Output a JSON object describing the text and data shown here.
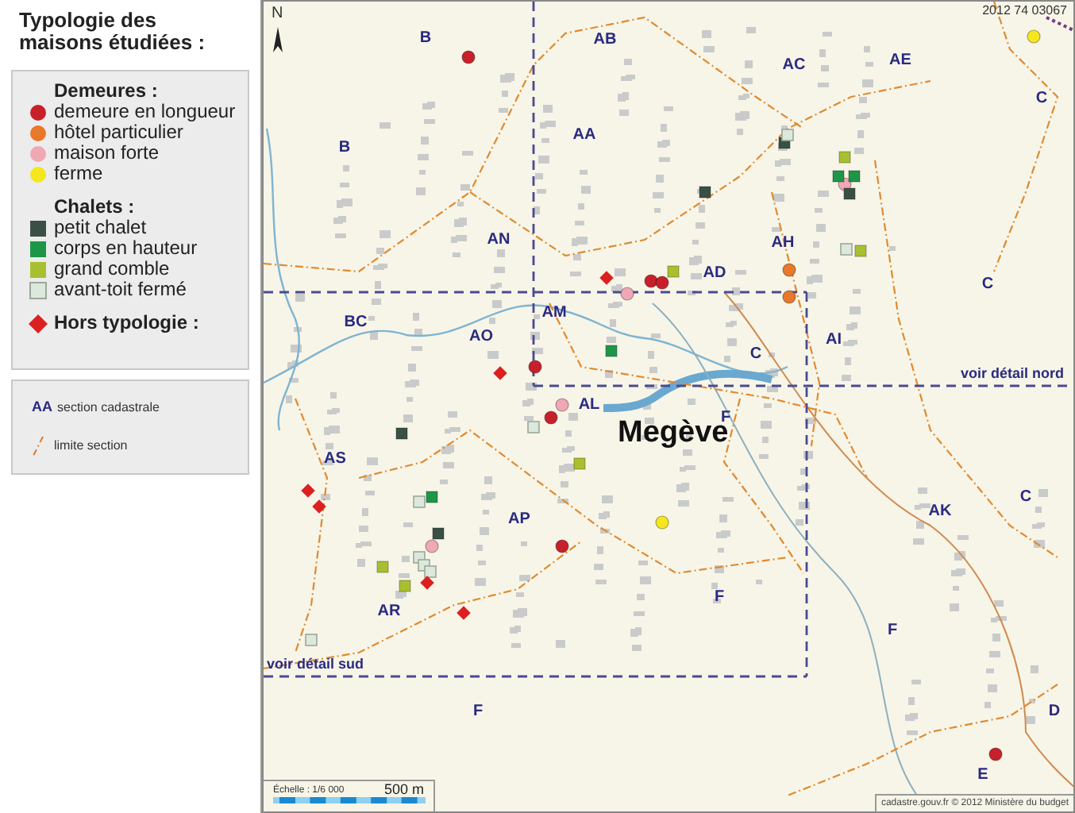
{
  "legend": {
    "title": "Typologie des maisons étudiées :",
    "groups": [
      {
        "title": "Demeures :",
        "items": [
          {
            "kind": "circle",
            "color": "#c8202a",
            "label": "demeure en longueur"
          },
          {
            "kind": "circle",
            "color": "#e8782a",
            "label": "hôtel particulier"
          },
          {
            "kind": "circle",
            "color": "#f0a8b4",
            "label": "maison forte"
          },
          {
            "kind": "circle",
            "color": "#f5e61e",
            "label": "ferme"
          }
        ]
      },
      {
        "title": "Chalets :",
        "items": [
          {
            "kind": "square",
            "color": "#3a5045",
            "label": "petit chalet"
          },
          {
            "kind": "square",
            "color": "#1e9648",
            "label": "corps en hauteur"
          },
          {
            "kind": "square",
            "color": "#a8c030",
            "label": "grand comble"
          },
          {
            "kind": "square",
            "color": "#dce8dc",
            "label": "avant-toit fermé"
          }
        ]
      },
      {
        "title": "Hors typologie :",
        "kind": "diamond",
        "color": "#dc2020"
      }
    ],
    "key": {
      "code": "AA",
      "code_label": "section cadastrale",
      "line_label": "limite section"
    }
  },
  "map": {
    "ref": "2012 74 03067",
    "north": "N",
    "town": "Megève",
    "detail_nord": "voir détail nord",
    "detail_sud": "voir détail sud",
    "scale": {
      "label": "Échelle : 1/6 000",
      "distance": "500 m"
    },
    "credit": "cadastre.gouv.fr © 2012 Ministère du budget",
    "sections": [
      {
        "text": "B"
      },
      {
        "text": "AB"
      },
      {
        "text": "AC"
      },
      {
        "text": "AE"
      },
      {
        "text": "C"
      },
      {
        "text": "B"
      },
      {
        "text": "AA"
      },
      {
        "text": "AN"
      },
      {
        "text": "AH"
      },
      {
        "text": "AD"
      },
      {
        "text": "C"
      },
      {
        "text": "BC"
      },
      {
        "text": "AM"
      },
      {
        "text": "AO"
      },
      {
        "text": "C"
      },
      {
        "text": "AI"
      },
      {
        "text": "AL"
      },
      {
        "text": "F"
      },
      {
        "text": "AS"
      },
      {
        "text": "AP"
      },
      {
        "text": "AK"
      },
      {
        "text": "C"
      },
      {
        "text": "AR"
      },
      {
        "text": "F"
      },
      {
        "text": "F"
      },
      {
        "text": "F"
      },
      {
        "text": "D"
      },
      {
        "text": "E"
      }
    ],
    "markers": [
      {
        "kind": "circle",
        "color": "#c8202a"
      },
      {
        "kind": "circle",
        "color": "#c8202a"
      },
      {
        "kind": "circle",
        "color": "#c8202a"
      },
      {
        "kind": "circle",
        "color": "#c8202a"
      },
      {
        "kind": "circle",
        "color": "#c8202a"
      },
      {
        "kind": "circle",
        "color": "#c8202a"
      },
      {
        "kind": "circle",
        "color": "#c8202a"
      },
      {
        "kind": "circle",
        "color": "#e8782a"
      },
      {
        "kind": "circle",
        "color": "#e8782a"
      },
      {
        "kind": "circle",
        "color": "#f0a8b4"
      },
      {
        "kind": "circle",
        "color": "#f0a8b4"
      },
      {
        "kind": "circle",
        "color": "#f0a8b4"
      },
      {
        "kind": "circle",
        "color": "#f0a8b4"
      },
      {
        "kind": "circle",
        "color": "#f5e61e"
      },
      {
        "kind": "circle",
        "color": "#f5e61e"
      },
      {
        "kind": "square",
        "color": "#3a5045"
      },
      {
        "kind": "square",
        "color": "#3a5045"
      },
      {
        "kind": "square",
        "color": "#3a5045"
      },
      {
        "kind": "square",
        "color": "#3a5045"
      },
      {
        "kind": "square",
        "color": "#3a5045"
      },
      {
        "kind": "square",
        "color": "#1e9648"
      },
      {
        "kind": "square",
        "color": "#1e9648"
      },
      {
        "kind": "square",
        "color": "#1e9648"
      },
      {
        "kind": "square",
        "color": "#1e9648"
      },
      {
        "kind": "square",
        "color": "#a8c030"
      },
      {
        "kind": "square",
        "color": "#a8c030"
      },
      {
        "kind": "square",
        "color": "#a8c030"
      },
      {
        "kind": "square",
        "color": "#a8c030"
      },
      {
        "kind": "square",
        "color": "#a8c030"
      },
      {
        "kind": "square",
        "color": "#a8c030"
      },
      {
        "kind": "square",
        "color": "#dce8dc"
      },
      {
        "kind": "square",
        "color": "#dce8dc"
      },
      {
        "kind": "square",
        "color": "#dce8dc"
      },
      {
        "kind": "square",
        "color": "#dce8dc"
      },
      {
        "kind": "square",
        "color": "#dce8dc"
      },
      {
        "kind": "square",
        "color": "#dce8dc"
      },
      {
        "kind": "square",
        "color": "#dce8dc"
      },
      {
        "kind": "square",
        "color": "#dce8dc"
      },
      {
        "kind": "diamond",
        "color": "#dc2020"
      },
      {
        "kind": "diamond",
        "color": "#dc2020"
      },
      {
        "kind": "diamond",
        "color": "#dc2020"
      },
      {
        "kind": "diamond",
        "color": "#dc2020"
      },
      {
        "kind": "diamond",
        "color": "#dc2020"
      },
      {
        "kind": "diamond",
        "color": "#dc2020"
      }
    ]
  }
}
